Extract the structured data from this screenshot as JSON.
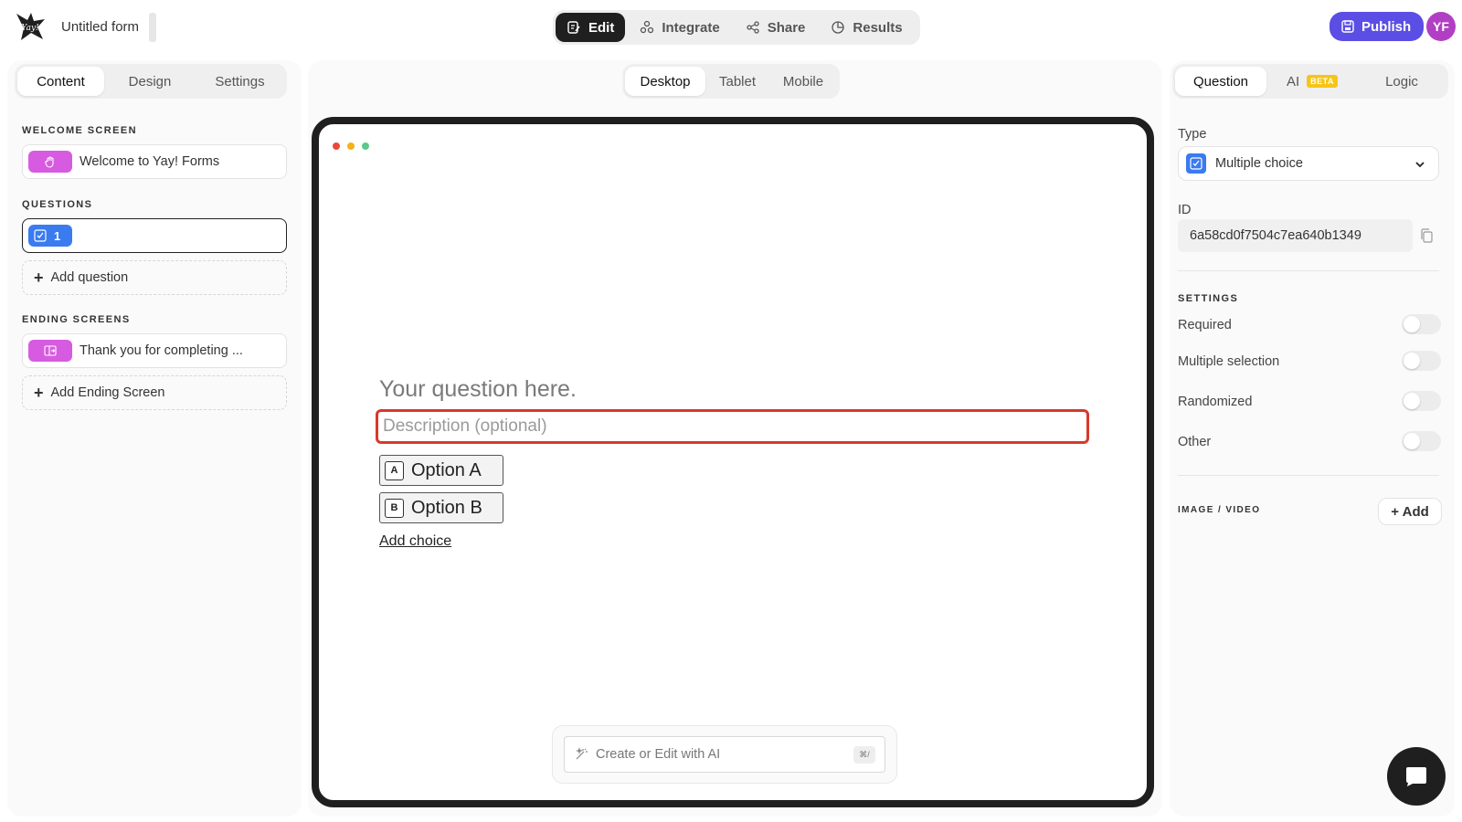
{
  "header": {
    "form_title": "Untitled form",
    "logo_text": "Yay!",
    "mode_tabs": [
      {
        "label": "Edit",
        "icon": "edit-icon",
        "active": true
      },
      {
        "label": "Integrate",
        "icon": "integrate-icon",
        "active": false
      },
      {
        "label": "Share",
        "icon": "share-icon",
        "active": false
      },
      {
        "label": "Results",
        "icon": "results-icon",
        "active": false
      }
    ],
    "publish_label": "Publish",
    "avatar_initials": "YF"
  },
  "left_panel": {
    "tabs": [
      {
        "label": "Content",
        "active": true
      },
      {
        "label": "Design",
        "active": false
      },
      {
        "label": "Settings",
        "active": false
      }
    ],
    "welcome_section_label": "WELCOME SCREEN",
    "welcome_item": "Welcome to Yay! Forms",
    "questions_section_label": "QUESTIONS",
    "question_item_number": "1",
    "add_question_label": "Add question",
    "ending_section_label": "ENDING SCREENS",
    "ending_item": "Thank you for completing ...",
    "add_ending_label": "Add Ending Screen"
  },
  "preview": {
    "device_tabs": [
      {
        "label": "Desktop",
        "active": true
      },
      {
        "label": "Tablet",
        "active": false
      },
      {
        "label": "Mobile",
        "active": false
      }
    ],
    "question_placeholder": "Your question here.",
    "description_placeholder": "Description (optional)",
    "options": [
      {
        "key": "A",
        "label": "Option A"
      },
      {
        "key": "B",
        "label": "Option B"
      }
    ],
    "add_choice_label": "Add choice",
    "ai_bar_placeholder": "Create or Edit with AI",
    "ai_shortcut": "⌘/"
  },
  "right_panel": {
    "tabs": [
      {
        "label": "Question",
        "active": true
      },
      {
        "label": "AI",
        "badge": "BETA",
        "active": false
      },
      {
        "label": "Logic",
        "active": false
      }
    ],
    "type_label": "Type",
    "type_value": "Multiple choice",
    "id_label": "ID",
    "id_value": "6a58cd0f7504c7ea640b1349",
    "settings_label": "SETTINGS",
    "settings": [
      {
        "label": "Required",
        "on": false
      },
      {
        "label": "Multiple selection",
        "on": false
      },
      {
        "label": "Randomized",
        "on": false
      },
      {
        "label": "Other",
        "on": false
      }
    ],
    "media_label": "IMAGE / VIDEO",
    "add_media_label": "+ Add"
  },
  "colors": {
    "accent": "#5b4ee5",
    "avatar": "#b13fc4",
    "question_badge": "#3a7bf0",
    "screen_badge": "#d75be0",
    "highlight_border": "#d8392b",
    "beta_badge": "#f5c518"
  }
}
